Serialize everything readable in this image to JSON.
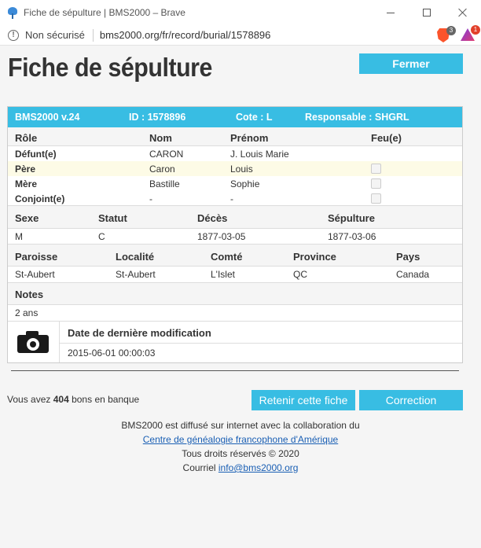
{
  "window": {
    "title": "Fiche de sépulture | BMS2000 – Brave",
    "not_secure": "Non sécurisé",
    "url": "bms2000.org/fr/record/burial/1578896",
    "brave_badge": "3",
    "rewards_badge": "1"
  },
  "page": {
    "title": "Fiche de sépulture",
    "close_button": "Fermer"
  },
  "record": {
    "version": "BMS2000 v.24",
    "id": "ID : 1578896",
    "cote": "Cote : L",
    "responsable": "Responsable : SHGRL",
    "persons_headers": [
      "Rôle",
      "Nom",
      "Prénom",
      "Feu(e)"
    ],
    "persons": [
      {
        "role": "Défunt(e)",
        "nom": "CARON",
        "prenom": "J. Louis Marie",
        "checkbox": false
      },
      {
        "role": "Père",
        "nom": "Caron",
        "prenom": "Louis",
        "checkbox": true
      },
      {
        "role": "Mère",
        "nom": "Bastille",
        "prenom": "Sophie",
        "checkbox": true
      },
      {
        "role": "Conjoint(e)",
        "nom": "-",
        "prenom": "-",
        "checkbox": true
      }
    ],
    "details_headers": [
      "Sexe",
      "Statut",
      "Décès",
      "Sépulture"
    ],
    "details": [
      "M",
      "C",
      "1877-03-05",
      "1877-03-06"
    ],
    "place_headers": [
      "Paroisse",
      "Localité",
      "Comté",
      "Province",
      "Pays"
    ],
    "place": [
      "St-Aubert",
      "St-Aubert",
      "L'Islet",
      "QC",
      "Canada"
    ],
    "notes_header": "Notes",
    "notes": "2 ans",
    "modified_header": "Date de dernière modification",
    "modified": "2015-06-01 00:00:03"
  },
  "actions": {
    "bank_prefix": "Vous avez ",
    "bank_count": "404",
    "bank_suffix": " bons en banque",
    "retain_button": "Retenir cette fiche",
    "correction_button": "Correction"
  },
  "footer": {
    "line1": "BMS2000 est diffusé sur internet avec la collaboration du",
    "link1": "Centre de généalogie francophone d'Amérique",
    "line3": "Tous droits réservés © 2020",
    "line4_prefix": "Courriel ",
    "email": "info@bms2000.org"
  }
}
